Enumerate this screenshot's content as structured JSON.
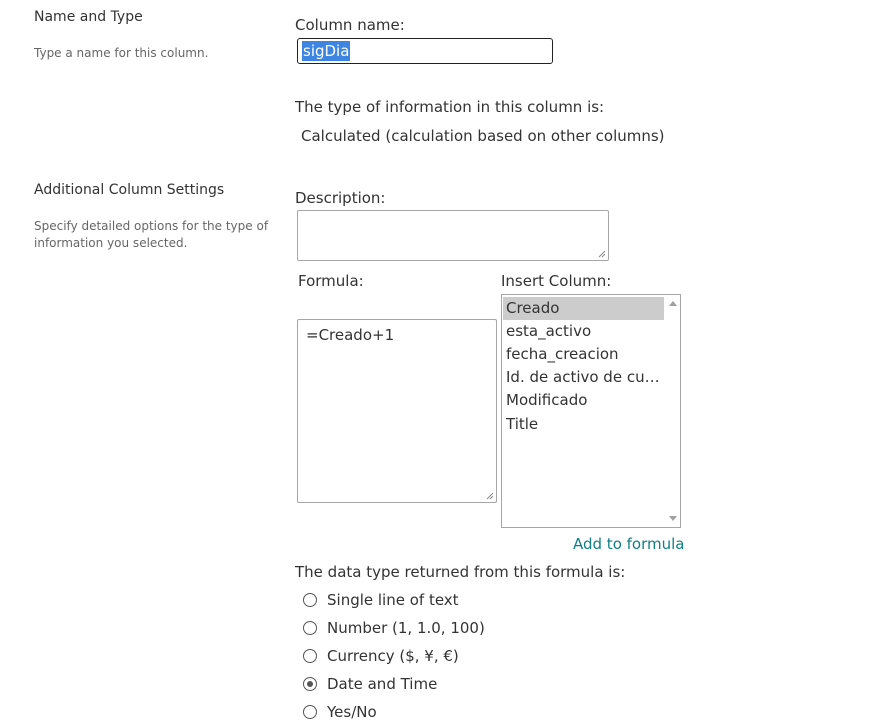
{
  "name_and_type": {
    "title": "Name and Type",
    "description": "Type a name for this column.",
    "column_name_label": "Column name:",
    "column_name_value": "sigDia",
    "type_info_label": "The type of information in this column is:",
    "type_info_value": "Calculated (calculation based on other columns)"
  },
  "additional_settings": {
    "title": "Additional Column Settings",
    "description": "Specify detailed options for the type of information you selected.",
    "description_label": "Description:",
    "description_value": "",
    "formula_label": "Formula:",
    "formula_value": "=Creado+1",
    "insert_column_label": "Insert Column:",
    "insert_columns": [
      {
        "label": "Creado",
        "selected": true
      },
      {
        "label": "esta_activo",
        "selected": false
      },
      {
        "label": "fecha_creacion",
        "selected": false
      },
      {
        "label": "Id. de activo de cum...",
        "selected": false
      },
      {
        "label": "Modificado",
        "selected": false
      },
      {
        "label": "Title",
        "selected": false
      }
    ],
    "add_to_formula": "Add to formula",
    "return_type_label": "The data type returned from this formula is:",
    "return_types": [
      {
        "label": "Single line of text",
        "checked": false
      },
      {
        "label": "Number (1, 1.0, 100)",
        "checked": false
      },
      {
        "label": "Currency ($, ¥, €)",
        "checked": false
      },
      {
        "label": "Date and Time",
        "checked": true
      },
      {
        "label": "Yes/No",
        "checked": false
      }
    ]
  },
  "colors": {
    "link": "#0f7f86",
    "selection": "#3d85e0",
    "list_selected": "#cccccc"
  }
}
